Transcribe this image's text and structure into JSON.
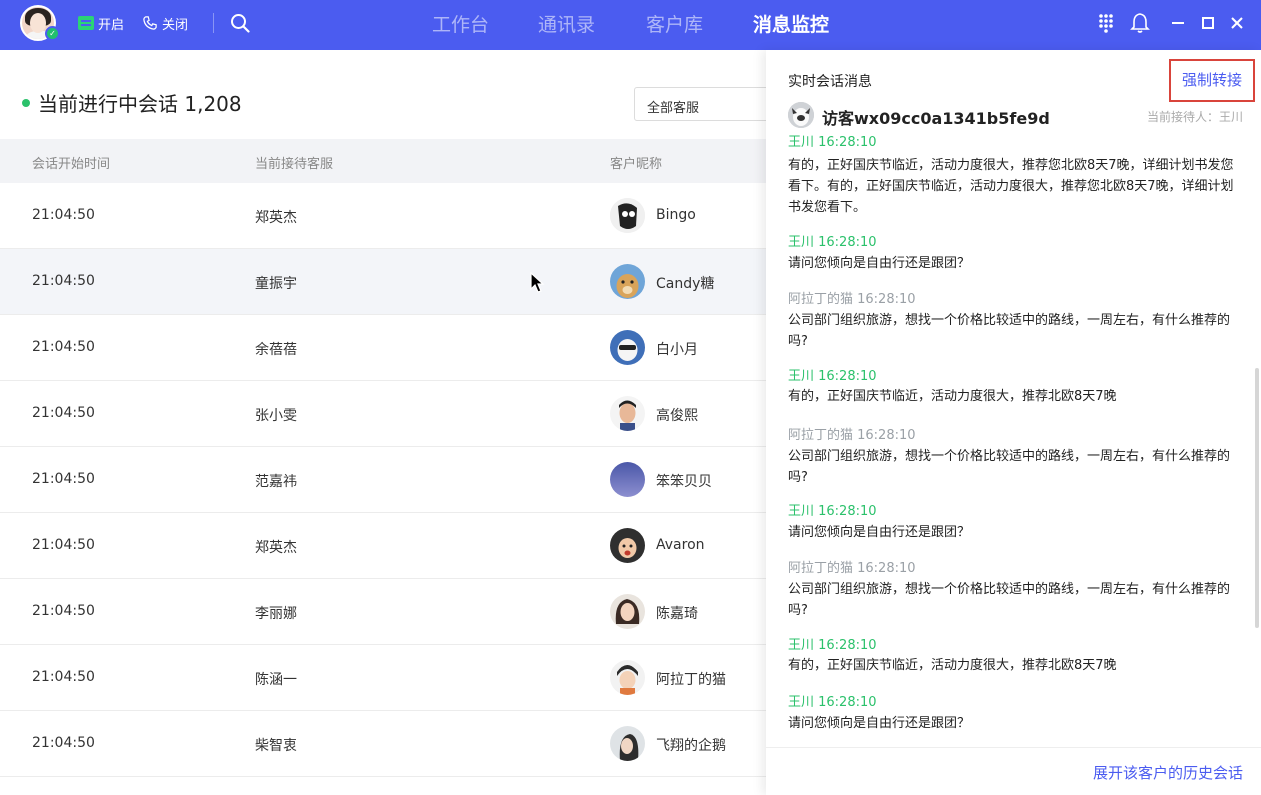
{
  "topbar": {
    "status_on_label": "开启",
    "status_off_label": "关闭",
    "nav": [
      {
        "label": "工作台",
        "active": false
      },
      {
        "label": "通讯录",
        "active": false
      },
      {
        "label": "客户库",
        "active": false
      },
      {
        "label": "消息监控",
        "active": true
      }
    ],
    "icons": [
      "dialpad-icon",
      "bell-icon",
      "minimize-icon",
      "maximize-icon",
      "close-icon"
    ]
  },
  "main": {
    "title": "当前进行中会话 1,208",
    "filter_select": "全部客服",
    "columns": [
      "会话开始时间",
      "当前接待客服",
      "客户昵称"
    ],
    "rows": [
      {
        "time": "21:04:50",
        "agent": "郑英杰",
        "customer": "Bingo"
      },
      {
        "time": "21:04:50",
        "agent": "童振宇",
        "customer": "Candy糖"
      },
      {
        "time": "21:04:50",
        "agent": "余蓓蓓",
        "customer": "白小月"
      },
      {
        "time": "21:04:50",
        "agent": "张小雯",
        "customer": "高俊熙"
      },
      {
        "time": "21:04:50",
        "agent": "范嘉祎",
        "customer": "笨笨贝贝"
      },
      {
        "time": "21:04:50",
        "agent": "郑英杰",
        "customer": "Avaron"
      },
      {
        "time": "21:04:50",
        "agent": "李丽娜",
        "customer": "陈嘉琦"
      },
      {
        "time": "21:04:50",
        "agent": "陈涵一",
        "customer": "阿拉丁的猫"
      },
      {
        "time": "21:04:50",
        "agent": "柴智衷",
        "customer": "飞翔的企鹅"
      }
    ]
  },
  "drawer": {
    "title": "实时会话消息",
    "force_transfer_button": "强制转接",
    "visitor_name": "访客wx09cc0a1341b5fe9d",
    "receiver": "当前接待人：王川",
    "messages": [
      {
        "sender": "王川 16:28:10",
        "role": "agent",
        "text": "有的，正好国庆节临近，活动力度很大，推荐您北欧8天7晚，详细计划书发您看下。有的，正好国庆节临近，活动力度很大，推荐您北欧8天7晚，详细计划书发您看下。"
      },
      {
        "sender": "王川 16:28:10",
        "role": "agent",
        "text": "请问您倾向是自由行还是跟团？"
      },
      {
        "sender": "阿拉丁的猫 16:28:10",
        "role": "cust",
        "text": "公司部门组织旅游，想找一个价格比较适中的路线，一周左右，有什么推荐的吗?"
      },
      {
        "sender": "王川 16:28:10",
        "role": "agent",
        "text": "有的，正好国庆节临近，活动力度很大，推荐北欧8天7晚"
      },
      {
        "sender": "阿拉丁的猫 16:28:10",
        "role": "cust",
        "text": "公司部门组织旅游，想找一个价格比较适中的路线，一周左右，有什么推荐的吗?"
      },
      {
        "sender": "王川 16:28:10",
        "role": "agent",
        "text": "请问您倾向是自由行还是跟团？"
      },
      {
        "sender": "阿拉丁的猫 16:28:10",
        "role": "cust",
        "text": "公司部门组织旅游，想找一个价格比较适中的路线，一周左右，有什么推荐的吗?"
      },
      {
        "sender": "王川 16:28:10",
        "role": "agent",
        "text": "有的，正好国庆节临近，活动力度很大，推荐北欧8天7晚"
      },
      {
        "sender": "王川 16:28:10",
        "role": "agent",
        "text": "请问您倾向是自由行还是跟团？"
      }
    ],
    "history_link": "展开该客户的历史会话"
  },
  "colors": {
    "primary": "#4b5cf0",
    "online": "#2bc16b",
    "highlight_border": "#d9443b"
  }
}
